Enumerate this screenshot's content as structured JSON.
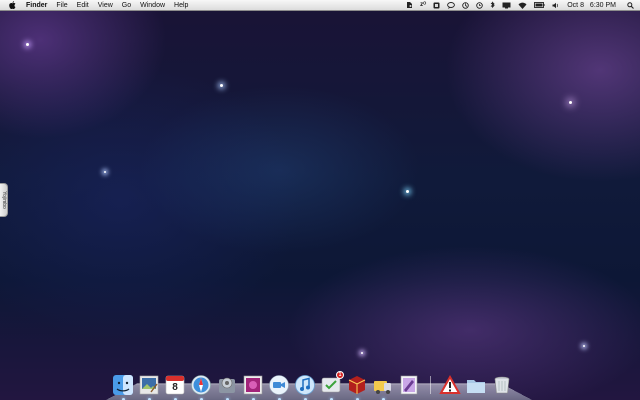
{
  "menubar": {
    "apple_icon": "apple-icon",
    "app_name": "Finder",
    "menus": [
      "File",
      "Edit",
      "View",
      "Go",
      "Window",
      "Help"
    ],
    "status_icons": [
      "evernote-icon",
      "sleep-icon",
      "dropbox-icon",
      "chat-icon",
      "sync-icon",
      "time-machine-icon",
      "bluetooth-icon",
      "display-icon",
      "wifi-icon",
      "battery-icon",
      "volume-icon"
    ],
    "sleep_text": "zᴼ",
    "date": "Oct 8",
    "time": "6:30 PM",
    "spotlight_icon": "search-icon"
  },
  "side_tab": {
    "label": "Yojimbo"
  },
  "dock": {
    "apps": [
      {
        "name": "finder-icon",
        "running": true
      },
      {
        "name": "preview-icon",
        "running": true
      },
      {
        "name": "ical-icon",
        "label": "8",
        "running": true
      },
      {
        "name": "safari-icon",
        "running": true
      },
      {
        "name": "system-preferences-icon",
        "running": true
      },
      {
        "name": "photo-booth-icon",
        "running": true
      },
      {
        "name": "facetime-icon",
        "running": true
      },
      {
        "name": "itunes-icon",
        "running": true
      },
      {
        "name": "app-store-icon",
        "badge": "1",
        "running": true
      },
      {
        "name": "package-icon",
        "running": true
      },
      {
        "name": "transmit-icon",
        "running": true
      },
      {
        "name": "pages-icon",
        "running": false
      }
    ],
    "stacks": [
      {
        "name": "warning-icon"
      },
      {
        "name": "folder-icon"
      },
      {
        "name": "trash-icon"
      }
    ]
  },
  "colors": {
    "accent": "#5a8fd6",
    "menubar": "#e6e6e6",
    "badge": "#d8201d"
  }
}
